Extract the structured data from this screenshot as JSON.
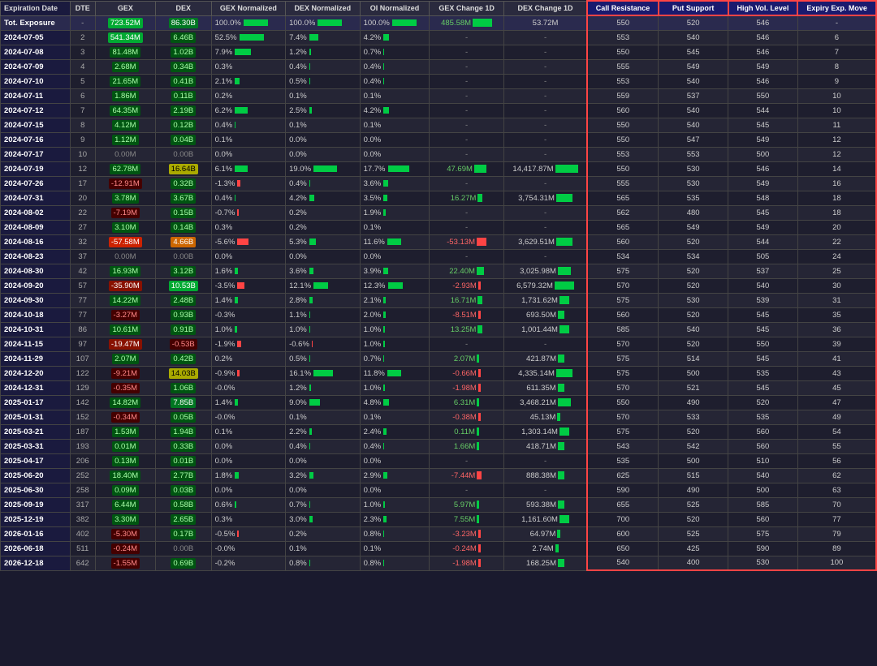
{
  "table": {
    "headers": [
      "Expiration Date",
      "DTE",
      "GEX",
      "DEX",
      "GEX Normalized",
      "DEX Normalized",
      "OI Normalized",
      "GEX Change 1D",
      "DEX Change 1D",
      "Call Resistance",
      "Put Support",
      "High Vol. Level",
      "Expiry Exp. Move"
    ],
    "rows": [
      {
        "date": "Tot. Exposure",
        "dte": "-",
        "gex": "723.52M",
        "gex_color": "green_bright",
        "dex": "86.30B",
        "dex_color": "green_mid",
        "gex_norm": "100.0%",
        "dex_norm": "100.0%",
        "oi_norm": "100.0%",
        "gex_1d": "485.58M",
        "gex_1d_bar": 8,
        "gex_1d_color": "green",
        "dex_1d": "53.72M",
        "dex_1d_bar": 0,
        "call_res": "550",
        "put_sup": "520",
        "high_vol": "546",
        "expiry_move": "-"
      },
      {
        "date": "2024-07-05",
        "dte": "2",
        "gex": "541.34M",
        "gex_color": "green_bright",
        "dex": "6.46B",
        "dex_color": "green_light",
        "gex_norm": "52.5%",
        "dex_norm": "7.4%",
        "oi_norm": "4.2%",
        "gex_1d": "-",
        "gex_1d_bar": 0,
        "gex_1d_color": "none",
        "dex_1d": "-",
        "dex_1d_bar": 0,
        "call_res": "553",
        "put_sup": "540",
        "high_vol": "546",
        "expiry_move": "6"
      },
      {
        "date": "2024-07-08",
        "dte": "3",
        "gex": "81.48M",
        "gex_color": "green_light",
        "dex": "1.02B",
        "dex_color": "green_light",
        "gex_norm": "7.9%",
        "dex_norm": "1.2%",
        "oi_norm": "0.7%",
        "gex_1d": "-",
        "gex_1d_bar": 0,
        "gex_1d_color": "none",
        "dex_1d": "-",
        "dex_1d_bar": 0,
        "call_res": "550",
        "put_sup": "545",
        "high_vol": "546",
        "expiry_move": "7"
      },
      {
        "date": "2024-07-09",
        "dte": "4",
        "gex": "2.68M",
        "gex_color": "green_light",
        "dex": "0.34B",
        "dex_color": "green_light",
        "gex_norm": "0.3%",
        "dex_norm": "0.4%",
        "oi_norm": "0.4%",
        "gex_1d": "-",
        "gex_1d_bar": 0,
        "gex_1d_color": "none",
        "dex_1d": "-",
        "dex_1d_bar": 0,
        "call_res": "555",
        "put_sup": "549",
        "high_vol": "549",
        "expiry_move": "8"
      },
      {
        "date": "2024-07-10",
        "dte": "5",
        "gex": "21.65M",
        "gex_color": "green_light",
        "dex": "0.41B",
        "dex_color": "green_light",
        "gex_norm": "2.1%",
        "dex_norm": "0.5%",
        "oi_norm": "0.4%",
        "gex_1d": "-",
        "gex_1d_bar": 0,
        "gex_1d_color": "none",
        "dex_1d": "-",
        "dex_1d_bar": 0,
        "call_res": "553",
        "put_sup": "540",
        "high_vol": "546",
        "expiry_move": "9"
      },
      {
        "date": "2024-07-11",
        "dte": "6",
        "gex": "1.86M",
        "gex_color": "green_light",
        "dex": "0.11B",
        "dex_color": "green_light",
        "gex_norm": "0.2%",
        "dex_norm": "0.1%",
        "oi_norm": "0.1%",
        "gex_1d": "-",
        "gex_1d_bar": 0,
        "gex_1d_color": "none",
        "dex_1d": "-",
        "dex_1d_bar": 0,
        "call_res": "559",
        "put_sup": "537",
        "high_vol": "550",
        "expiry_move": "10"
      },
      {
        "date": "2024-07-12",
        "dte": "7",
        "gex": "64.35M",
        "gex_color": "green_light",
        "dex": "2.19B",
        "dex_color": "green_light",
        "gex_norm": "6.2%",
        "dex_norm": "2.5%",
        "oi_norm": "4.2%",
        "gex_1d": "-",
        "gex_1d_bar": 0,
        "gex_1d_color": "none",
        "dex_1d": "-",
        "dex_1d_bar": 0,
        "call_res": "560",
        "put_sup": "540",
        "high_vol": "544",
        "expiry_move": "10"
      },
      {
        "date": "2024-07-15",
        "dte": "8",
        "gex": "4.12M",
        "gex_color": "green_light",
        "dex": "0.12B",
        "dex_color": "green_light",
        "gex_norm": "0.4%",
        "dex_norm": "0.1%",
        "oi_norm": "0.1%",
        "gex_1d": "-",
        "gex_1d_bar": 0,
        "gex_1d_color": "none",
        "dex_1d": "-",
        "dex_1d_bar": 0,
        "call_res": "550",
        "put_sup": "540",
        "high_vol": "545",
        "expiry_move": "11"
      },
      {
        "date": "2024-07-16",
        "dte": "9",
        "gex": "1.12M",
        "gex_color": "green_light",
        "dex": "0.04B",
        "dex_color": "green_light",
        "gex_norm": "0.1%",
        "dex_norm": "0.0%",
        "oi_norm": "0.0%",
        "gex_1d": "-",
        "gex_1d_bar": 0,
        "gex_1d_color": "none",
        "dex_1d": "-",
        "dex_1d_bar": 0,
        "call_res": "550",
        "put_sup": "547",
        "high_vol": "549",
        "expiry_move": "12"
      },
      {
        "date": "2024-07-17",
        "dte": "10",
        "gex": "0.00M",
        "gex_color": "neutral",
        "dex": "0.00B",
        "dex_color": "neutral",
        "gex_norm": "0.0%",
        "dex_norm": "0.0%",
        "oi_norm": "0.0%",
        "gex_1d": "-",
        "gex_1d_bar": 0,
        "gex_1d_color": "none",
        "dex_1d": "-",
        "dex_1d_bar": 0,
        "call_res": "553",
        "put_sup": "553",
        "high_vol": "500",
        "expiry_move": "12"
      },
      {
        "date": "2024-07-19",
        "dte": "12",
        "gex": "62.78M",
        "gex_color": "green_light",
        "dex": "16.64B",
        "dex_color": "yellow",
        "gex_norm": "6.1%",
        "dex_norm": "19.0%",
        "oi_norm": "17.7%",
        "gex_1d": "47.69M",
        "gex_1d_bar": 5,
        "gex_1d_color": "green",
        "dex_1d": "14,417.87M",
        "dex_1d_bar": 7,
        "call_res": "550",
        "put_sup": "530",
        "high_vol": "546",
        "expiry_move": "14"
      },
      {
        "date": "2024-07-26",
        "dte": "17",
        "gex": "-12.91M",
        "gex_color": "red_light",
        "dex": "0.32B",
        "dex_color": "green_light",
        "gex_norm": "-1.3%",
        "dex_norm": "0.4%",
        "oi_norm": "3.6%",
        "gex_1d": "-",
        "gex_1d_bar": 0,
        "gex_1d_color": "none",
        "dex_1d": "-",
        "dex_1d_bar": 0,
        "call_res": "555",
        "put_sup": "530",
        "high_vol": "549",
        "expiry_move": "16"
      },
      {
        "date": "2024-07-31",
        "dte": "20",
        "gex": "3.78M",
        "gex_color": "green_light",
        "dex": "3.67B",
        "dex_color": "green_light",
        "gex_norm": "0.4%",
        "dex_norm": "4.2%",
        "oi_norm": "3.5%",
        "gex_1d": "16.27M",
        "gex_1d_bar": 2,
        "gex_1d_color": "green",
        "dex_1d": "3,754.31M",
        "dex_1d_bar": 5,
        "call_res": "565",
        "put_sup": "535",
        "high_vol": "548",
        "expiry_move": "18"
      },
      {
        "date": "2024-08-02",
        "dte": "22",
        "gex": "-7.19M",
        "gex_color": "red_light",
        "dex": "0.15B",
        "dex_color": "green_light",
        "gex_norm": "-0.7%",
        "dex_norm": "0.2%",
        "oi_norm": "1.9%",
        "gex_1d": "-",
        "gex_1d_bar": 0,
        "gex_1d_color": "none",
        "dex_1d": "-",
        "dex_1d_bar": 0,
        "call_res": "562",
        "put_sup": "480",
        "high_vol": "545",
        "expiry_move": "18"
      },
      {
        "date": "2024-08-09",
        "dte": "27",
        "gex": "3.10M",
        "gex_color": "green_light",
        "dex": "0.14B",
        "dex_color": "green_light",
        "gex_norm": "0.3%",
        "dex_norm": "0.2%",
        "oi_norm": "0.1%",
        "gex_1d": "-",
        "gex_1d_bar": 0,
        "gex_1d_color": "none",
        "dex_1d": "-",
        "dex_1d_bar": 0,
        "call_res": "565",
        "put_sup": "549",
        "high_vol": "549",
        "expiry_move": "20"
      },
      {
        "date": "2024-08-16",
        "dte": "32",
        "gex": "-57.58M",
        "gex_color": "red_bright",
        "dex": "4.66B",
        "dex_color": "orange",
        "gex_norm": "-5.6%",
        "dex_norm": "5.3%",
        "oi_norm": "11.6%",
        "gex_1d": "-53.13M",
        "gex_1d_bar": 4,
        "gex_1d_color": "red",
        "dex_1d": "3,629.51M",
        "dex_1d_bar": 5,
        "call_res": "560",
        "put_sup": "520",
        "high_vol": "544",
        "expiry_move": "22"
      },
      {
        "date": "2024-08-23",
        "dte": "37",
        "gex": "0.00M",
        "gex_color": "neutral",
        "dex": "0.00B",
        "dex_color": "neutral",
        "gex_norm": "0.0%",
        "dex_norm": "0.0%",
        "oi_norm": "0.0%",
        "gex_1d": "-",
        "gex_1d_bar": 0,
        "gex_1d_color": "none",
        "dex_1d": "-",
        "dex_1d_bar": 0,
        "call_res": "534",
        "put_sup": "534",
        "high_vol": "505",
        "expiry_move": "24"
      },
      {
        "date": "2024-08-30",
        "dte": "42",
        "gex": "16.93M",
        "gex_color": "green_light",
        "dex": "3.12B",
        "dex_color": "green_light",
        "gex_norm": "1.6%",
        "dex_norm": "3.6%",
        "oi_norm": "3.9%",
        "gex_1d": "22.40M",
        "gex_1d_bar": 3,
        "gex_1d_color": "green",
        "dex_1d": "3,025.98M",
        "dex_1d_bar": 4,
        "call_res": "575",
        "put_sup": "520",
        "high_vol": "537",
        "expiry_move": "25"
      },
      {
        "date": "2024-09-20",
        "dte": "57",
        "gex": "-35.90M",
        "gex_color": "red_mid",
        "dex": "10.53B",
        "dex_color": "green_bright",
        "gex_norm": "-3.5%",
        "dex_norm": "12.1%",
        "oi_norm": "12.3%",
        "gex_1d": "-2.93M",
        "gex_1d_bar": 1,
        "gex_1d_color": "red",
        "dex_1d": "6,579.32M",
        "dex_1d_bar": 6,
        "call_res": "570",
        "put_sup": "520",
        "high_vol": "540",
        "expiry_move": "30"
      },
      {
        "date": "2024-09-30",
        "dte": "77",
        "gex": "14.22M",
        "gex_color": "green_light",
        "dex": "2.48B",
        "dex_color": "green_light",
        "gex_norm": "1.4%",
        "dex_norm": "2.8%",
        "oi_norm": "2.1%",
        "gex_1d": "16.71M",
        "gex_1d_bar": 2,
        "gex_1d_color": "green",
        "dex_1d": "1,731.62M",
        "dex_1d_bar": 3,
        "call_res": "575",
        "put_sup": "530",
        "high_vol": "539",
        "expiry_move": "31"
      },
      {
        "date": "2024-10-18",
        "dte": "77",
        "gex": "-3.27M",
        "gex_color": "red_light",
        "dex": "0.93B",
        "dex_color": "green_light",
        "gex_norm": "-0.3%",
        "dex_norm": "1.1%",
        "oi_norm": "2.0%",
        "gex_1d": "-8.51M",
        "gex_1d_bar": 1,
        "gex_1d_color": "red",
        "dex_1d": "693.50M",
        "dex_1d_bar": 2,
        "call_res": "560",
        "put_sup": "520",
        "high_vol": "545",
        "expiry_move": "35"
      },
      {
        "date": "2024-10-31",
        "dte": "86",
        "gex": "10.61M",
        "gex_color": "green_light",
        "dex": "0.91B",
        "dex_color": "green_light",
        "gex_norm": "1.0%",
        "dex_norm": "1.0%",
        "oi_norm": "1.0%",
        "gex_1d": "13.25M",
        "gex_1d_bar": 2,
        "gex_1d_color": "green",
        "dex_1d": "1,001.44M",
        "dex_1d_bar": 3,
        "call_res": "585",
        "put_sup": "540",
        "high_vol": "545",
        "expiry_move": "36"
      },
      {
        "date": "2024-11-15",
        "dte": "97",
        "gex": "-19.47M",
        "gex_color": "red_mid",
        "dex": "-0.53B",
        "dex_color": "red_light",
        "gex_norm": "-1.9%",
        "dex_norm": "-0.6%",
        "oi_norm": "1.0%",
        "gex_1d": "-",
        "gex_1d_bar": 0,
        "gex_1d_color": "none",
        "dex_1d": "-",
        "dex_1d_bar": 0,
        "call_res": "570",
        "put_sup": "520",
        "high_vol": "550",
        "expiry_move": "39"
      },
      {
        "date": "2024-11-29",
        "dte": "107",
        "gex": "2.07M",
        "gex_color": "green_light",
        "dex": "0.42B",
        "dex_color": "green_light",
        "gex_norm": "0.2%",
        "dex_norm": "0.5%",
        "oi_norm": "0.7%",
        "gex_1d": "2.07M",
        "gex_1d_bar": 1,
        "gex_1d_color": "green",
        "dex_1d": "421.87M",
        "dex_1d_bar": 2,
        "call_res": "575",
        "put_sup": "514",
        "high_vol": "545",
        "expiry_move": "41"
      },
      {
        "date": "2024-12-20",
        "dte": "122",
        "gex": "-9.21M",
        "gex_color": "red_light",
        "dex": "14.03B",
        "dex_color": "yellow",
        "gex_norm": "-0.9%",
        "dex_norm": "16.1%",
        "oi_norm": "11.8%",
        "gex_1d": "-0.66M",
        "gex_1d_bar": 1,
        "gex_1d_color": "red",
        "dex_1d": "4,335.14M",
        "dex_1d_bar": 5,
        "call_res": "575",
        "put_sup": "500",
        "high_vol": "535",
        "expiry_move": "43"
      },
      {
        "date": "2024-12-31",
        "dte": "129",
        "gex": "-0.35M",
        "gex_color": "red_light",
        "dex": "1.06B",
        "dex_color": "green_light",
        "gex_norm": "-0.0%",
        "dex_norm": "1.2%",
        "oi_norm": "1.0%",
        "gex_1d": "-1.98M",
        "gex_1d_bar": 1,
        "gex_1d_color": "red",
        "dex_1d": "611.35M",
        "dex_1d_bar": 2,
        "call_res": "570",
        "put_sup": "521",
        "high_vol": "545",
        "expiry_move": "45"
      },
      {
        "date": "2025-01-17",
        "dte": "142",
        "gex": "14.82M",
        "gex_color": "green_light",
        "dex": "7.85B",
        "dex_color": "green_mid",
        "gex_norm": "1.4%",
        "dex_norm": "9.0%",
        "oi_norm": "4.8%",
        "gex_1d": "6.31M",
        "gex_1d_bar": 1,
        "gex_1d_color": "green",
        "dex_1d": "3,468.21M",
        "dex_1d_bar": 4,
        "call_res": "550",
        "put_sup": "490",
        "high_vol": "520",
        "expiry_move": "47"
      },
      {
        "date": "2025-01-31",
        "dte": "152",
        "gex": "-0.34M",
        "gex_color": "red_light",
        "dex": "0.05B",
        "dex_color": "green_light",
        "gex_norm": "-0.0%",
        "dex_norm": "0.1%",
        "oi_norm": "0.1%",
        "gex_1d": "-0.38M",
        "gex_1d_bar": 1,
        "gex_1d_color": "red",
        "dex_1d": "45.13M",
        "dex_1d_bar": 1,
        "call_res": "570",
        "put_sup": "533",
        "high_vol": "535",
        "expiry_move": "49"
      },
      {
        "date": "2025-03-21",
        "dte": "187",
        "gex": "1.53M",
        "gex_color": "green_light",
        "dex": "1.94B",
        "dex_color": "green_light",
        "gex_norm": "0.1%",
        "dex_norm": "2.2%",
        "oi_norm": "2.4%",
        "gex_1d": "0.11M",
        "gex_1d_bar": 1,
        "gex_1d_color": "green",
        "dex_1d": "1,303.14M",
        "dex_1d_bar": 3,
        "call_res": "575",
        "put_sup": "520",
        "high_vol": "560",
        "expiry_move": "54"
      },
      {
        "date": "2025-03-31",
        "dte": "193",
        "gex": "0.01M",
        "gex_color": "green_light",
        "dex": "0.33B",
        "dex_color": "green_light",
        "gex_norm": "0.0%",
        "dex_norm": "0.4%",
        "oi_norm": "0.4%",
        "gex_1d": "1.66M",
        "gex_1d_bar": 1,
        "gex_1d_color": "green",
        "dex_1d": "418.71M",
        "dex_1d_bar": 2,
        "call_res": "543",
        "put_sup": "542",
        "high_vol": "560",
        "expiry_move": "55"
      },
      {
        "date": "2025-04-17",
        "dte": "206",
        "gex": "0.13M",
        "gex_color": "green_light",
        "dex": "0.01B",
        "dex_color": "green_light",
        "gex_norm": "0.0%",
        "dex_norm": "0.0%",
        "oi_norm": "0.0%",
        "gex_1d": "-",
        "gex_1d_bar": 0,
        "gex_1d_color": "none",
        "dex_1d": "-",
        "dex_1d_bar": 0,
        "call_res": "535",
        "put_sup": "500",
        "high_vol": "510",
        "expiry_move": "56"
      },
      {
        "date": "2025-06-20",
        "dte": "252",
        "gex": "18.40M",
        "gex_color": "green_light",
        "dex": "2.77B",
        "dex_color": "green_light",
        "gex_norm": "1.8%",
        "dex_norm": "3.2%",
        "oi_norm": "2.9%",
        "gex_1d": "-7.44M",
        "gex_1d_bar": 2,
        "gex_1d_color": "red",
        "dex_1d": "888.38M",
        "dex_1d_bar": 2,
        "call_res": "625",
        "put_sup": "515",
        "high_vol": "540",
        "expiry_move": "62"
      },
      {
        "date": "2025-06-30",
        "dte": "258",
        "gex": "0.09M",
        "gex_color": "green_light",
        "dex": "0.03B",
        "dex_color": "green_light",
        "gex_norm": "0.0%",
        "dex_norm": "0.0%",
        "oi_norm": "0.0%",
        "gex_1d": "-",
        "gex_1d_bar": 0,
        "gex_1d_color": "none",
        "dex_1d": "-",
        "dex_1d_bar": 0,
        "call_res": "590",
        "put_sup": "490",
        "high_vol": "500",
        "expiry_move": "63"
      },
      {
        "date": "2025-09-19",
        "dte": "317",
        "gex": "6.44M",
        "gex_color": "green_light",
        "dex": "0.58B",
        "dex_color": "green_light",
        "gex_norm": "0.6%",
        "dex_norm": "0.7%",
        "oi_norm": "1.0%",
        "gex_1d": "5.97M",
        "gex_1d_bar": 1,
        "gex_1d_color": "green",
        "dex_1d": "593.38M",
        "dex_1d_bar": 2,
        "call_res": "655",
        "put_sup": "525",
        "high_vol": "585",
        "expiry_move": "70"
      },
      {
        "date": "2025-12-19",
        "dte": "382",
        "gex": "3.30M",
        "gex_color": "green_light",
        "dex": "2.65B",
        "dex_color": "green_light",
        "gex_norm": "0.3%",
        "dex_norm": "3.0%",
        "oi_norm": "2.3%",
        "gex_1d": "7.55M",
        "gex_1d_bar": 1,
        "gex_1d_color": "green",
        "dex_1d": "1,161.60M",
        "dex_1d_bar": 3,
        "call_res": "700",
        "put_sup": "520",
        "high_vol": "560",
        "expiry_move": "77"
      },
      {
        "date": "2026-01-16",
        "dte": "402",
        "gex": "-5.30M",
        "gex_color": "red_light",
        "dex": "0.17B",
        "dex_color": "green_light",
        "gex_norm": "-0.5%",
        "dex_norm": "0.2%",
        "oi_norm": "0.8%",
        "gex_1d": "-3.23M",
        "gex_1d_bar": 1,
        "gex_1d_color": "red",
        "dex_1d": "64.97M",
        "dex_1d_bar": 1,
        "call_res": "600",
        "put_sup": "525",
        "high_vol": "575",
        "expiry_move": "79"
      },
      {
        "date": "2026-06-18",
        "dte": "511",
        "gex": "-0.24M",
        "gex_color": "red_light",
        "dex": "0.00B",
        "dex_color": "neutral",
        "gex_norm": "-0.0%",
        "dex_norm": "0.1%",
        "oi_norm": "0.1%",
        "gex_1d": "-0.24M",
        "gex_1d_bar": 1,
        "gex_1d_color": "red",
        "dex_1d": "2.74M",
        "dex_1d_bar": 1,
        "call_res": "650",
        "put_sup": "425",
        "high_vol": "590",
        "expiry_move": "89"
      },
      {
        "date": "2026-12-18",
        "dte": "642",
        "gex": "-1.55M",
        "gex_color": "red_light",
        "dex": "0.69B",
        "dex_color": "green_light",
        "gex_norm": "-0.2%",
        "dex_norm": "0.8%",
        "oi_norm": "0.8%",
        "gex_1d": "-1.98M",
        "gex_1d_bar": 1,
        "gex_1d_color": "red",
        "dex_1d": "168.25M",
        "dex_1d_bar": 2,
        "call_res": "540",
        "put_sup": "400",
        "high_vol": "530",
        "expiry_move": "100"
      }
    ]
  }
}
